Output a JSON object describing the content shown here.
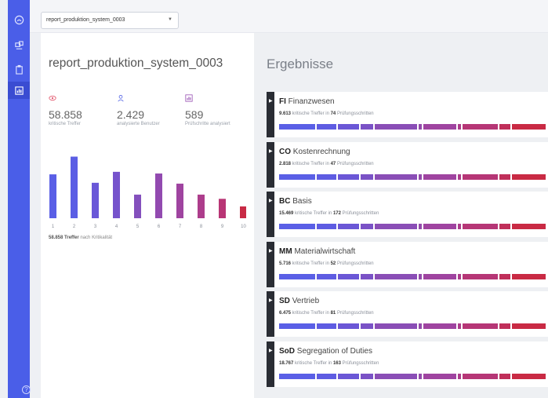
{
  "selector": {
    "value": "report_produktion_system_0003"
  },
  "report": {
    "title": "report_produktion_system_0003"
  },
  "stats": [
    {
      "icon": "eye-icon",
      "value": "58.858",
      "label": "kritische Treffer",
      "color": "#e2546a"
    },
    {
      "icon": "user-icon",
      "value": "2.429",
      "label": "analysierte Benutzer",
      "color": "#5a6ae6"
    },
    {
      "icon": "chart-icon",
      "value": "589",
      "label": "Prüfschritte analysiert",
      "color": "#9b57b6"
    }
  ],
  "chart_data": {
    "type": "bar",
    "categories": [
      "1",
      "2",
      "3",
      "4",
      "5",
      "6",
      "7",
      "8",
      "9",
      "10"
    ],
    "values": [
      52,
      73,
      42,
      55,
      28,
      53,
      41,
      28,
      23,
      14
    ],
    "ylim": [
      0,
      80
    ],
    "colors": [
      "#5a5fe6",
      "#5b5ee4",
      "#6a58d8",
      "#7653cc",
      "#8450bd",
      "#924ab0",
      "#9f44a0",
      "#ad3d8c",
      "#b83575",
      "#c82a45"
    ]
  },
  "caption": {
    "count": "58.858",
    "text_1": "Treffer",
    "text_2": " nach Kritikalität"
  },
  "results": {
    "title": "Ergebnisse",
    "cards": [
      {
        "code": "FI",
        "name": "Finanzwesen",
        "hits": "9.613",
        "hits_text": " kritische Treffer in ",
        "steps": "74",
        "steps_text": " Prüfungsschritten"
      },
      {
        "code": "CO",
        "name": "Kostenrechnung",
        "hits": "2.818",
        "hits_text": " kritische Treffer in ",
        "steps": "47",
        "steps_text": " Prüfungsschritten"
      },
      {
        "code": "BC",
        "name": "Basis",
        "hits": "15.469",
        "hits_text": " kritische Treffer in ",
        "steps": "172",
        "steps_text": " Prüfungsschritten"
      },
      {
        "code": "MM",
        "name": "Materialwirtschaft",
        "hits": "5.716",
        "hits_text": " kritische Treffer in ",
        "steps": "52",
        "steps_text": " Prüfungsschritten"
      },
      {
        "code": "SD",
        "name": "Vertrieb",
        "hits": "6.475",
        "hits_text": " kritische Treffer in ",
        "steps": "81",
        "steps_text": " Prüfungsschritten"
      },
      {
        "code": "SoD",
        "name": "Segregation of Duties",
        "hits": "18.767",
        "hits_text": " kritische Treffer in ",
        "steps": "163",
        "steps_text": " Prüfungsschritten"
      }
    ]
  },
  "nav": [
    {
      "icon": "dashboard-icon"
    },
    {
      "icon": "systems-icon"
    },
    {
      "icon": "clipboard-icon"
    },
    {
      "icon": "reports-icon",
      "active": true
    }
  ],
  "help_glyph": "?"
}
